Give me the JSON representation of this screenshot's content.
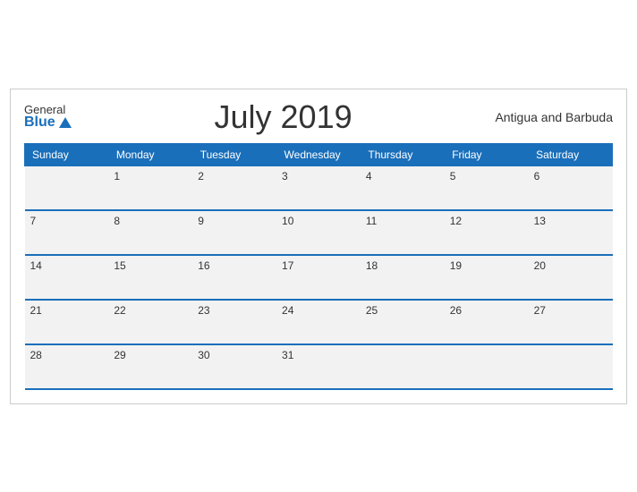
{
  "header": {
    "logo_general": "General",
    "logo_blue": "Blue",
    "month_title": "July 2019",
    "country": "Antigua and Barbuda"
  },
  "weekdays": [
    "Sunday",
    "Monday",
    "Tuesday",
    "Wednesday",
    "Thursday",
    "Friday",
    "Saturday"
  ],
  "weeks": [
    [
      "",
      "1",
      "2",
      "3",
      "4",
      "5",
      "6"
    ],
    [
      "7",
      "8",
      "9",
      "10",
      "11",
      "12",
      "13"
    ],
    [
      "14",
      "15",
      "16",
      "17",
      "18",
      "19",
      "20"
    ],
    [
      "21",
      "22",
      "23",
      "24",
      "25",
      "26",
      "27"
    ],
    [
      "28",
      "29",
      "30",
      "31",
      "",
      "",
      ""
    ]
  ]
}
